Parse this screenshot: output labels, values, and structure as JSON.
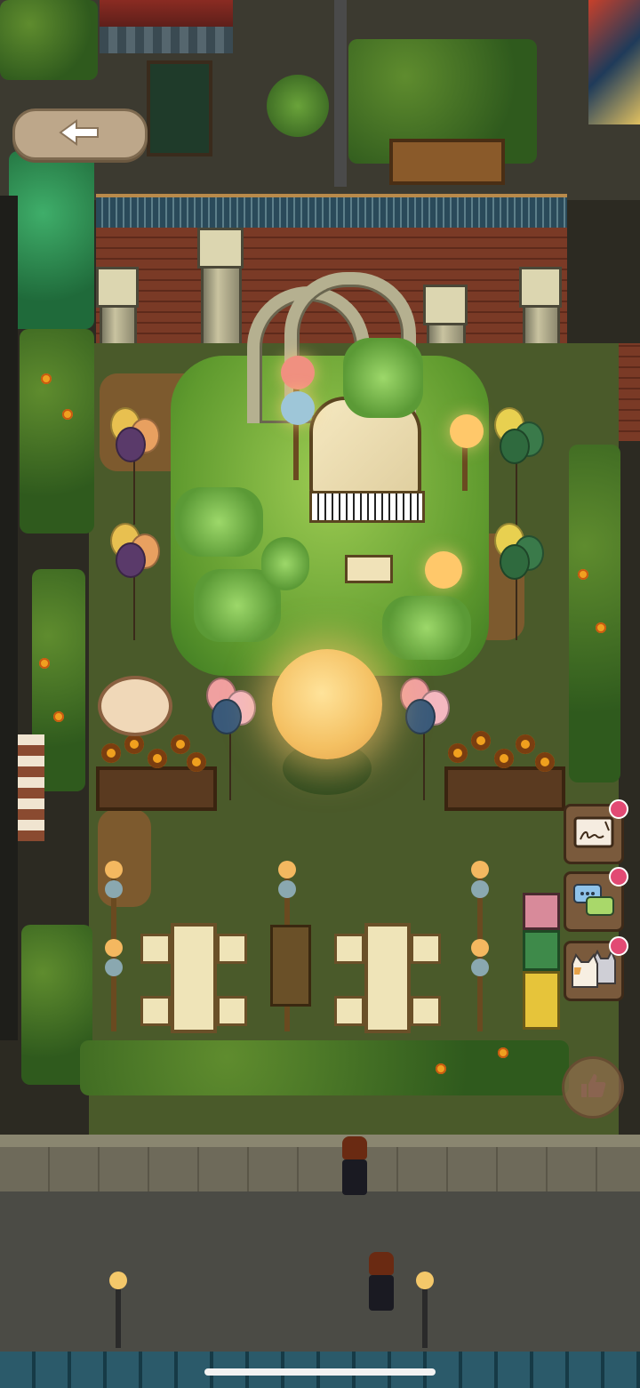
{
  "scene": {
    "title_sign": "",
    "colors": {
      "lawn": "#7cb342",
      "brick": "#7a3a26",
      "moon": "#f4c062",
      "ui_button": "#bda78a",
      "badge": "#e24a74"
    }
  },
  "ui": {
    "back_button": {
      "icon": "arrow-left-icon"
    },
    "side_menu": [
      {
        "icon": "chalkboard-icon",
        "has_badge": true
      },
      {
        "icon": "chat-bubbles-icon",
        "has_badge": true
      },
      {
        "icon": "cats-icon",
        "has_badge": true
      }
    ],
    "thumb_button": {
      "icon": "thumbs-up-icon"
    }
  }
}
